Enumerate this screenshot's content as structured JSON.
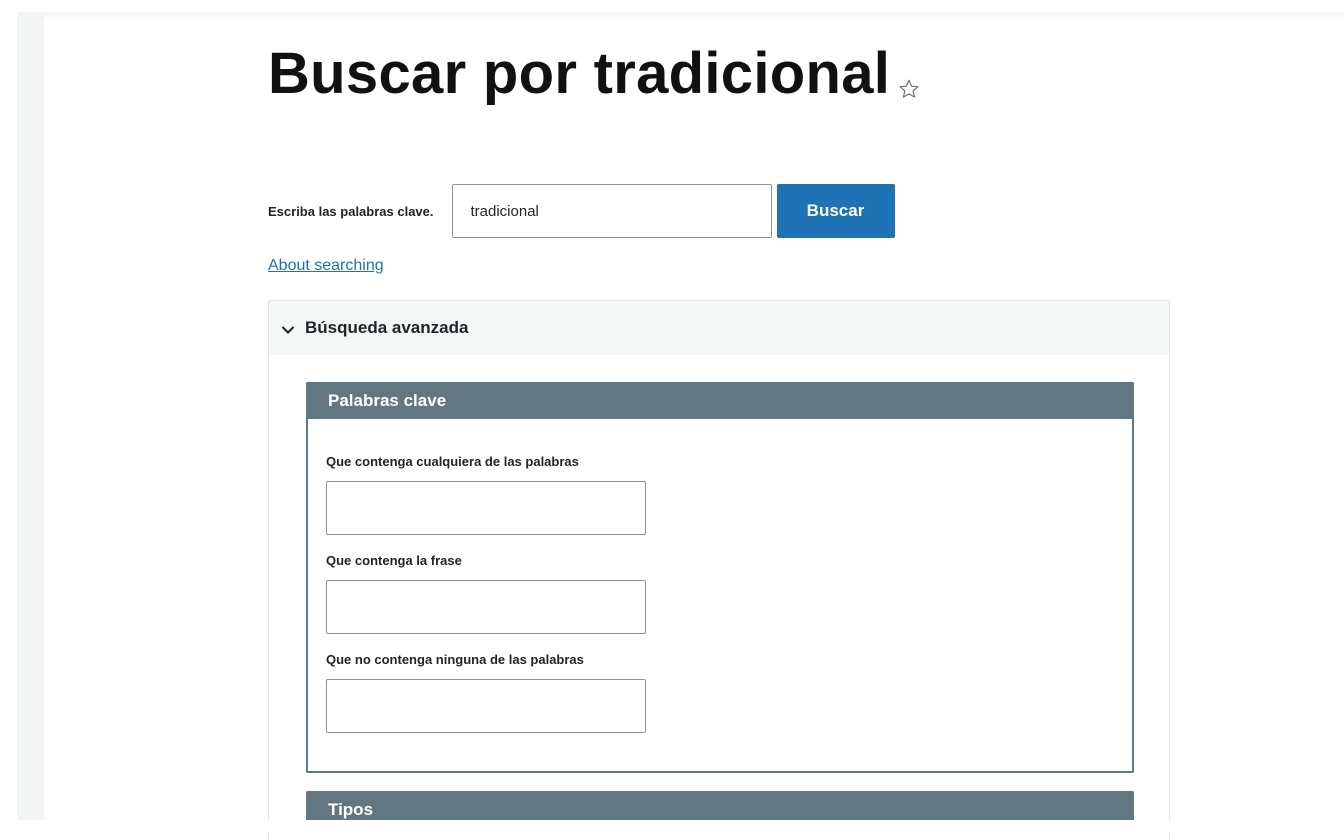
{
  "page": {
    "title": "Buscar por tradicional",
    "favorite_icon": "star-outline-icon"
  },
  "search": {
    "label": "Escriba las palabras clave.",
    "value": "tradicional",
    "button_label": "Buscar"
  },
  "help": {
    "link_label": "About searching"
  },
  "advanced": {
    "summary_label": "Búsqueda avanzada",
    "expanded": true,
    "keywords": {
      "legend": "Palabras clave",
      "fields": [
        {
          "label": "Que contenga cualquiera de las palabras",
          "value": ""
        },
        {
          "label": "Que contenga la frase",
          "value": ""
        },
        {
          "label": "Que no contenga ninguna de las palabras",
          "value": ""
        }
      ]
    },
    "types": {
      "legend": "Tipos"
    }
  },
  "colors": {
    "accent": "#1e73b4",
    "fieldset_header": "#637783"
  }
}
